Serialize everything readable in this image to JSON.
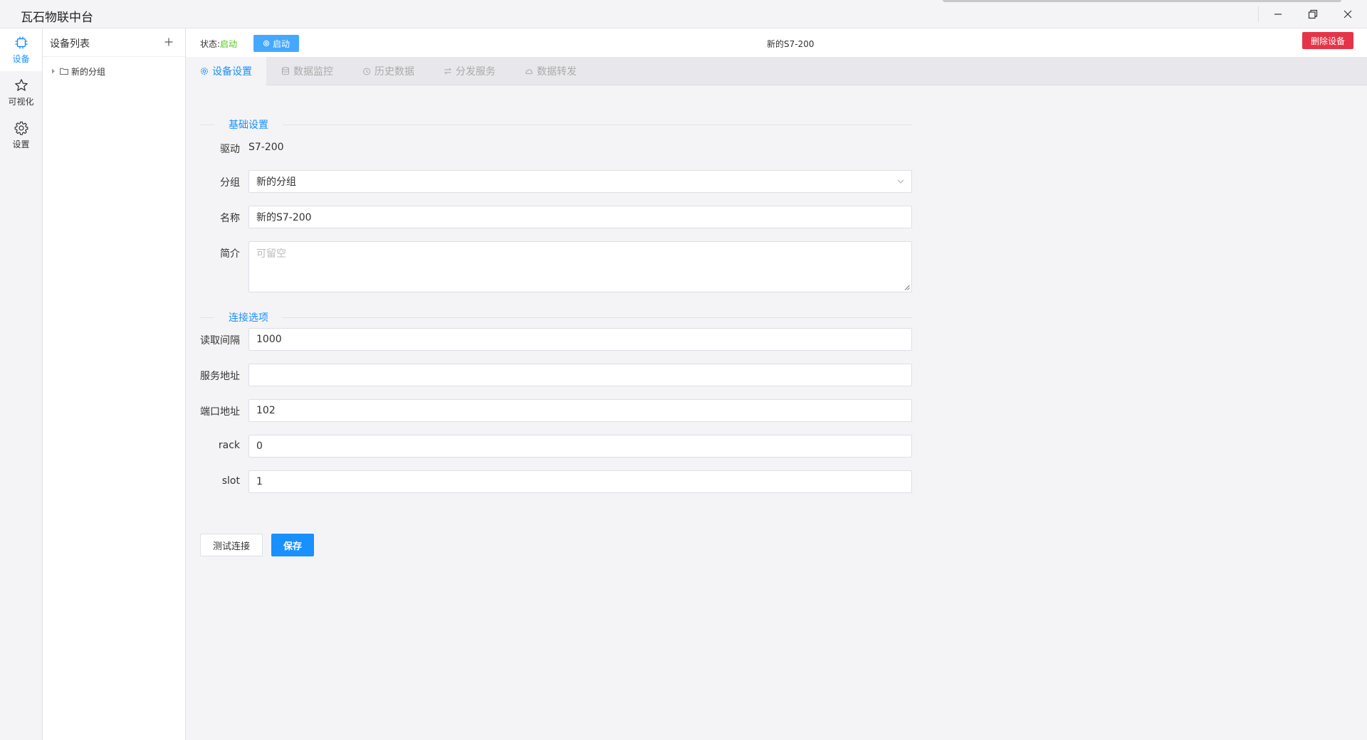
{
  "app": {
    "title": "瓦石物联中台"
  },
  "window_controls": {
    "minimize": "minimize-icon",
    "maximize": "restore-icon",
    "close": "close-icon"
  },
  "rail": {
    "items": [
      {
        "label": "设备",
        "icon": "chip-icon",
        "active": true
      },
      {
        "label": "可视化",
        "icon": "star-icon",
        "active": false
      },
      {
        "label": "设置",
        "icon": "gear-icon",
        "active": false
      }
    ]
  },
  "device_list": {
    "title": "设备列表",
    "add_icon": "plus-icon",
    "groups": [
      {
        "label": "新的分组",
        "icon": "folder-icon"
      }
    ]
  },
  "status_bar": {
    "status_label": "状态:",
    "status_value": "启动",
    "start_button": "启动",
    "device_name": "新的S7-200",
    "delete_button": "删除设备"
  },
  "tabs": [
    {
      "label": "设备设置",
      "icon": "gear-icon",
      "active": true
    },
    {
      "label": "数据监控",
      "icon": "database-icon",
      "active": false
    },
    {
      "label": "历史数据",
      "icon": "clock-icon",
      "active": false
    },
    {
      "label": "分发服务",
      "icon": "exchange-icon",
      "active": false
    },
    {
      "label": "数据转发",
      "icon": "cloud-icon",
      "active": false
    }
  ],
  "form": {
    "section_basic": "基础设置",
    "driver_label": "驱动",
    "driver_value": "S7-200",
    "group_label": "分组",
    "group_value": "新的分组",
    "name_label": "名称",
    "name_value": "新的S7-200",
    "desc_label": "简介",
    "desc_placeholder": "可留空",
    "section_conn": "连接选项",
    "interval_label": "读取间隔",
    "interval_value": "1000",
    "host_label": "服务地址",
    "host_value": "",
    "port_label": "端口地址",
    "port_value": "102",
    "rack_label": "rack",
    "rack_value": "0",
    "slot_label": "slot",
    "slot_value": "1",
    "test_button": "测试连接",
    "save_button": "保存"
  },
  "colors": {
    "accent": "#1890ff",
    "danger": "#e53448",
    "status_ok": "#52c41a"
  }
}
